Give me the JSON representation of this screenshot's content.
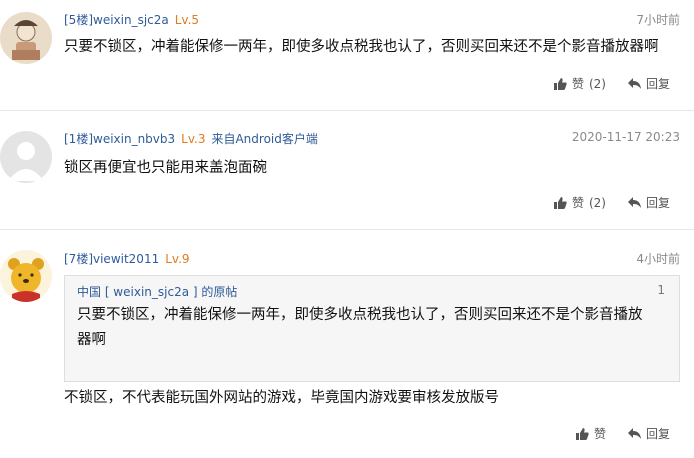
{
  "comments": [
    {
      "floor": "[5楼]",
      "user": "weixin_sjc2a",
      "level": "Lv.5",
      "source": "",
      "time": "7小时前",
      "text": "只要不锁区，冲着能保修一两年，即使多收点税我也认了，否则买回来还不是个影音播放器啊",
      "like_label": "赞",
      "like_count": "(2)",
      "reply_label": "回复"
    },
    {
      "floor": "[1楼]",
      "user": "weixin_nbvb3",
      "level": "Lv.3",
      "source": "来自Android客户端",
      "time": "2020-11-17 20:23",
      "text": "锁区再便宜也只能用来盖泡面碗",
      "like_label": "赞",
      "like_count": "(2)",
      "reply_label": "回复"
    },
    {
      "floor": "[7楼]",
      "user": "viewit2011",
      "level": "Lv.9",
      "source": "",
      "time": "4小时前",
      "quote": {
        "header": "中国 [ weixin_sjc2a ] 的原帖",
        "number": "1",
        "text": "只要不锁区，冲着能保修一两年，即使多收点税我也认了，否则买回来还不是个影音播放器啊"
      },
      "text": "不锁区，不代表能玩国外网站的游戏，毕竟国内游戏要审核发放版号",
      "like_label": "赞",
      "like_count": "",
      "reply_label": "回复"
    }
  ]
}
